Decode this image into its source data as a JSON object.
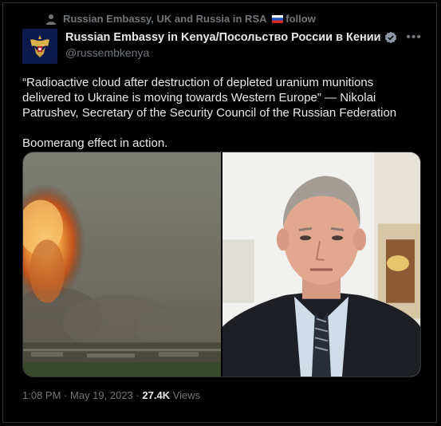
{
  "retweet": {
    "label": "Russian Embassy, UK and Russia in RSA",
    "follow_label": "follow"
  },
  "author": {
    "name": "Russian Embassy in Kenya/Посольство России в Кении",
    "handle": "@russembkenya"
  },
  "tweet": {
    "paragraphs": [
      "“Radioactive cloud after destruction of depleted uranium munitions delivered to Ukraine is moving towards Western Europe” — Nikolai Patrushev, Secretary of the Security Council of the Russian Federation",
      "Boomerang effect in action."
    ]
  },
  "media": [
    {
      "icon": "explosion-photo"
    },
    {
      "icon": "portrait-photo"
    }
  ],
  "meta": {
    "time": "1:08 PM",
    "separator": "·",
    "date": "May 19, 2023",
    "views_count": "27.4K",
    "views_label": "Views"
  },
  "colors": {
    "background": "#000000",
    "text": "#e7e9ea",
    "muted": "#71767b",
    "verified": "#1d9bf0",
    "border": "#2f3336"
  }
}
